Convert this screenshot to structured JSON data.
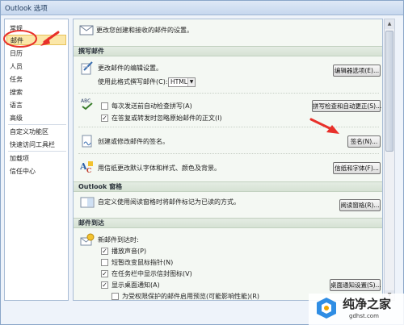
{
  "window": {
    "title": "Outlook 选项"
  },
  "sidebar": {
    "items": [
      {
        "label": "常规"
      },
      {
        "label": "邮件"
      },
      {
        "label": "日历"
      },
      {
        "label": "人员"
      },
      {
        "label": "任务"
      },
      {
        "label": "搜索"
      },
      {
        "label": "语言"
      },
      {
        "label": "高级"
      },
      {
        "label": "自定义功能区"
      },
      {
        "label": "快速访问工具栏"
      },
      {
        "label": "加载项"
      },
      {
        "label": "信任中心"
      }
    ],
    "selected": "邮件"
  },
  "main": {
    "intro": "更改您创建和接收的邮件的设置。",
    "compose": {
      "header": "撰写邮件",
      "edit_text": "更改邮件的编辑设置。",
      "format_label": "使用此格式撰写邮件(C):",
      "format_value": "HTML",
      "editor_button": "编辑器选项(E)...",
      "spell_check_auto": {
        "label": "每次发送前自动检查拼写(A)",
        "checked": false
      },
      "ignore_original": {
        "label": "在答复或转发时忽略原始邮件的正文(I)",
        "checked": true
      },
      "spelling_button": "拼写检查和自动更正(S)...",
      "signature_text": "创建或修改邮件的签名。",
      "signature_button": "签名(N)...",
      "stationery_text": "用信纸更改默认字体和样式、颜色及背景。",
      "stationery_button": "信纸和字体(F)..."
    },
    "panes": {
      "header": "Outlook 窗格",
      "reading_text": "自定义使用阅读窗格时将邮件标记为已读的方式。",
      "reading_button": "阅读窗格(R)..."
    },
    "arrival": {
      "header": "邮件到达",
      "when_text": "新邮件到达时:",
      "play_sound": {
        "label": "播放声音(P)",
        "checked": true
      },
      "change_cursor": {
        "label": "短暂改变鼠标指针(N)",
        "checked": false
      },
      "taskbar_icon": {
        "label": "在任务栏中显示信封图标(V)",
        "checked": true
      },
      "desktop_alert": {
        "label": "显示桌面通知(A)",
        "checked": true
      },
      "preview_rights": {
        "label": "为受权限保护的邮件启用预览(可能影响性能)(R)",
        "checked": false
      },
      "alert_button": "桌面通知设置(S)..."
    }
  },
  "watermark": {
    "text": "纯净之家",
    "url": "gdhst.com"
  },
  "colors": {
    "highlight": "#fbe7a8",
    "annotation": "#e8302a",
    "content_bg": "#f4f8f3",
    "section_bg": "#d6e2d4"
  }
}
